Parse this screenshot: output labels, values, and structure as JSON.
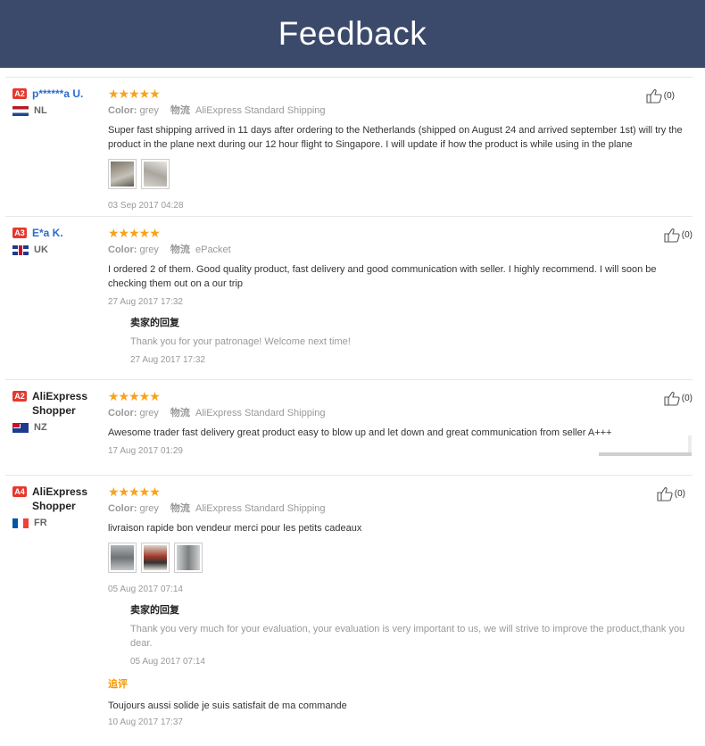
{
  "header": {
    "title": "Feedback"
  },
  "reviews": [
    {
      "level": "A2",
      "user": "p******a U.",
      "country": "NL",
      "stars": "★★★★★",
      "color_label": "Color:",
      "color_value": "grey",
      "shipping_label": "物流",
      "shipping_value": "AliExpress Standard Shipping",
      "text": "Super fast shipping arrived in 11 days after ordering to the Netherlands (shipped on August 24 and arrived september 1st) will try the product in the plane next during our 12 hour flight to Singapore. I will update if how the product is while using in the plane",
      "date": "03 Sep 2017 04:28",
      "likes": "(0)"
    },
    {
      "level": "A3",
      "user": "E*a K.",
      "country": "UK",
      "stars": "★★★★★",
      "color_label": "Color:",
      "color_value": "grey",
      "shipping_label": "物流",
      "shipping_value": "ePacket",
      "text": "I ordered 2 of them. Good quality product, fast delivery and good communication with seller. I highly recommend. I will soon be checking them out on a our trip",
      "date": "27 Aug 2017 17:32",
      "reply_title": "卖家的回复",
      "reply_text": "Thank you for your patronage! Welcome next time!",
      "reply_date": "27 Aug 2017 17:32",
      "likes": "(0)"
    },
    {
      "level": "A2",
      "user": "AliExpress Shopper",
      "country": "NZ",
      "stars": "★★★★★",
      "color_label": "Color:",
      "color_value": "grey",
      "shipping_label": "物流",
      "shipping_value": "AliExpress Standard Shipping",
      "text": "Awesome trader fast delivery great product easy to blow up and let down and great communication from seller A+++",
      "date": "17 Aug 2017 01:29",
      "likes": "(0)"
    },
    {
      "level": "A4",
      "user": "AliExpress Shopper",
      "country": "FR",
      "stars": "★★★★★",
      "color_label": "Color:",
      "color_value": "grey",
      "shipping_label": "物流",
      "shipping_value": "AliExpress Standard Shipping",
      "text": "livraison rapide bon vendeur merci pour les petits cadeaux",
      "date": "05 Aug 2017 07:14",
      "reply_title": "卖家的回复",
      "reply_text": "Thank you very much for your evaluation, your evaluation is very important to us, we will strive to improve the product,thank you dear.",
      "reply_date": "05 Aug 2017 07:14",
      "additional_title": "追评",
      "additional_text": "Toujours aussi solide je suis satisfait de ma commande",
      "additional_date": "10 Aug 2017 17:37",
      "likes": "(0)"
    }
  ]
}
